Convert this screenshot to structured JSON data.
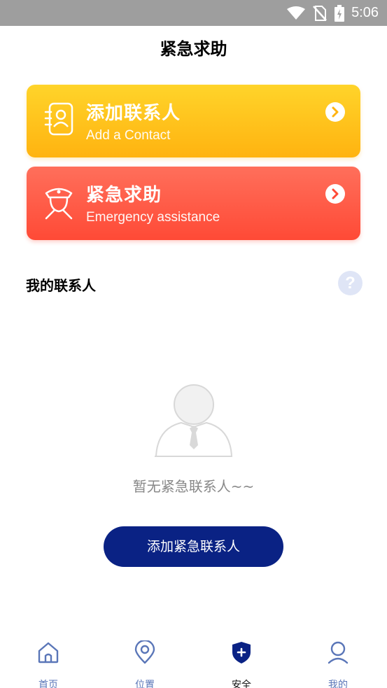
{
  "status_bar": {
    "time": "5:06"
  },
  "page": {
    "title": "紧急求助"
  },
  "cards": {
    "add_contact": {
      "title": "添加联系人",
      "subtitle": "Add a Contact"
    },
    "emergency": {
      "title": "紧急求助",
      "subtitle": "Emergency assistance"
    }
  },
  "contacts": {
    "section_title": "我的联系人",
    "help_glyph": "?",
    "empty_text": "暂无紧急联系人~~",
    "add_button_label": "添加紧急联系人"
  },
  "tabbar": {
    "items": [
      {
        "label": "首页",
        "icon": "home-icon"
      },
      {
        "label": "位置",
        "icon": "location-icon"
      },
      {
        "label": "安全",
        "icon": "shield-icon",
        "active": true
      },
      {
        "label": "我的",
        "icon": "user-icon"
      }
    ]
  },
  "colors": {
    "status_bar": "#9e9e9e",
    "contact_card": "#ffc21a",
    "emergency_card": "#ff5a45",
    "primary_button": "#0a2284",
    "tab_inactive": "#5a76b8",
    "tab_active": "#0a2284"
  }
}
